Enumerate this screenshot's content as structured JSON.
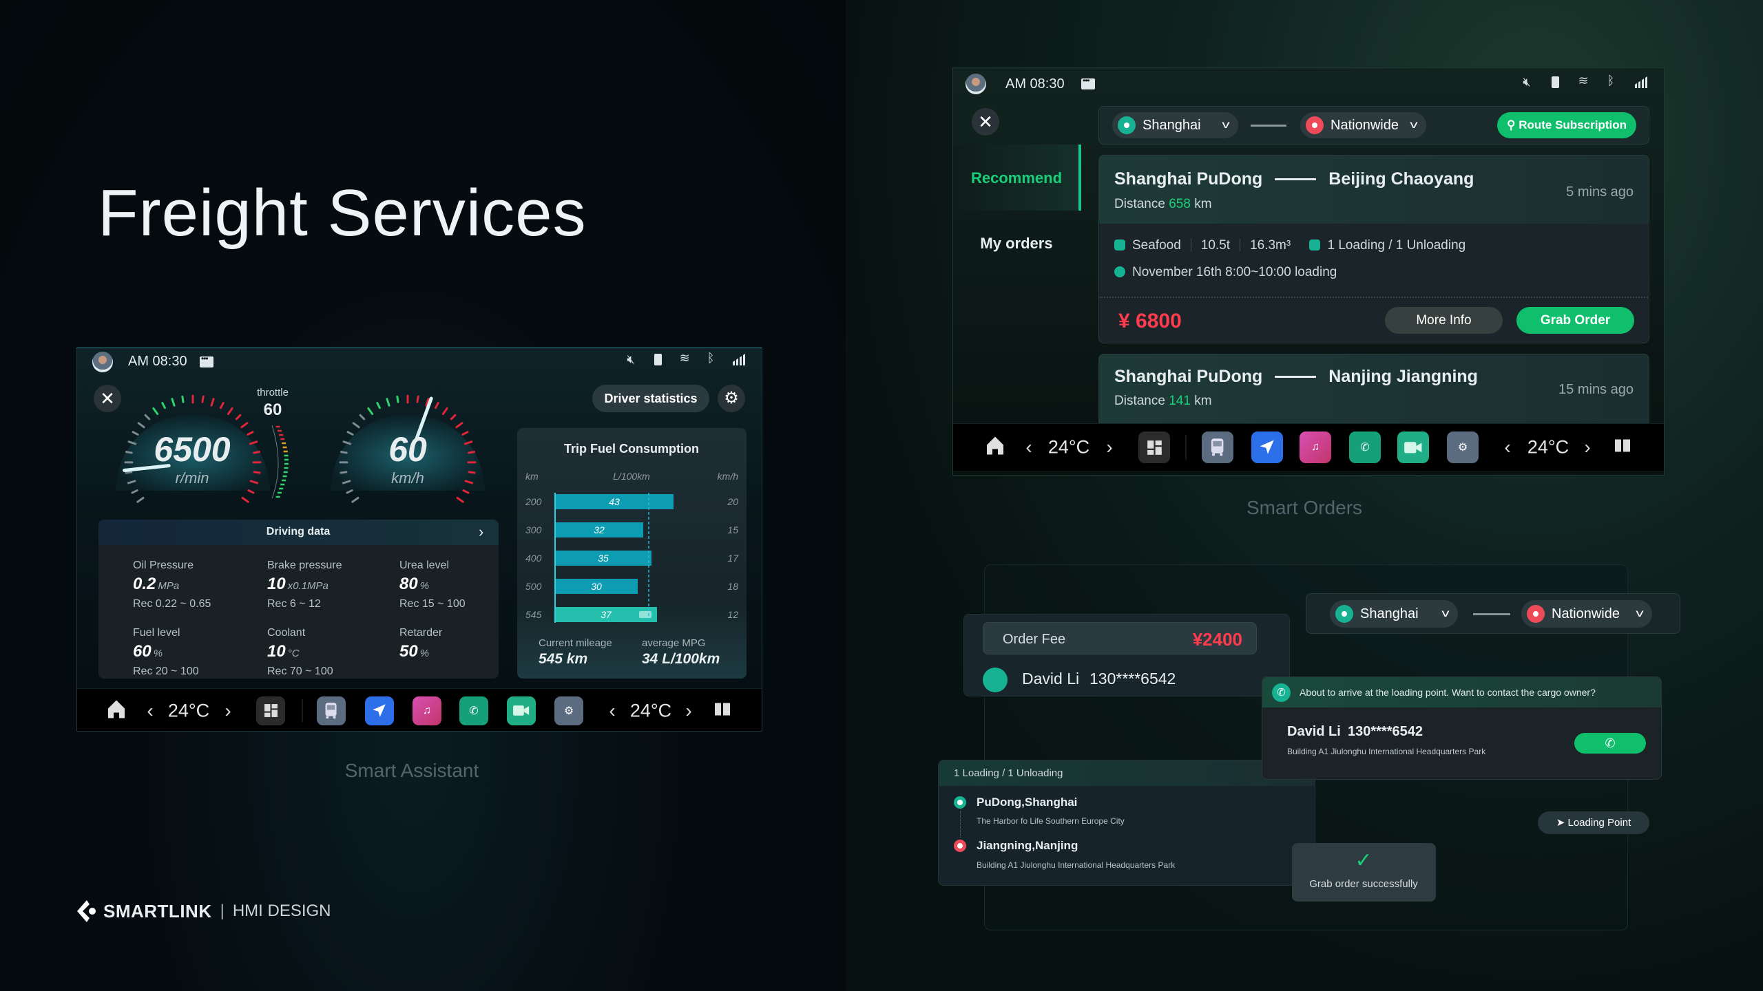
{
  "title": "Freight Services",
  "brand": {
    "name": "SMARTLINK",
    "separator": "|",
    "tagline": "HMI DESIGN"
  },
  "colors": {
    "accent_green": "#0fbf6c",
    "price_red": "#ff3b4e",
    "teal_bar": "#0e9cb3",
    "current_bar": "#25bfae"
  },
  "dock": {
    "temperature_left": "24°C",
    "temperature_right": "24°C",
    "icons": [
      "home-icon",
      "chevron-left-icon",
      "chevron-right-icon",
      "widgets-icon",
      "truck-app-icon",
      "navigation-app-icon",
      "music-app-icon",
      "phone-app-icon",
      "video-app-icon",
      "settings-app-icon",
      "split-screen-icon"
    ]
  },
  "assistant": {
    "caption": "Smart Assistant",
    "status": {
      "time": "AM 08:30"
    },
    "rpm": {
      "value": "6500",
      "unit": "r/min"
    },
    "throttle": {
      "label": "throttle",
      "value": "60"
    },
    "speed": {
      "value": "60",
      "unit": "km/h"
    },
    "driver_stats_label": "Driver statistics",
    "driving_data": {
      "title": "Driving data",
      "items": [
        {
          "label": "Oil Pressure",
          "value": "0.2",
          "unit": "MPa",
          "rec": "Rec 0.22 ~ 0.65"
        },
        {
          "label": "Brake pressure",
          "value": "10",
          "unit": "x0.1MPa",
          "rec": "Rec 6 ~ 12"
        },
        {
          "label": "Urea level",
          "value": "80",
          "unit": "%",
          "rec": "Rec 15 ~ 100"
        },
        {
          "label": "Fuel level",
          "value": "60",
          "unit": "%",
          "rec": "Rec 20 ~ 100"
        },
        {
          "label": "Coolant",
          "value": "10",
          "unit": "°C",
          "rec": "Rec 70 ~ 100"
        },
        {
          "label": "Retarder",
          "value": "50",
          "unit": "%",
          "rec": ""
        }
      ]
    },
    "fuel_summary": {
      "mileage_label": "Current mileage",
      "mileage_value": "545 km",
      "mpg_label": "average MPG",
      "mpg_value": "34 L/100km"
    }
  },
  "chart_data": {
    "type": "bar",
    "orientation": "horizontal",
    "title": "Trip Fuel Consumption",
    "left_axis_label": "km",
    "xlabel": "L/100km",
    "right_axis_label": "km/h",
    "categories": [
      "200",
      "300",
      "400",
      "500",
      "545"
    ],
    "values": [
      43,
      32,
      35,
      30,
      37
    ],
    "right_values": [
      "20",
      "15",
      "17",
      "18",
      "12"
    ],
    "average_line": 34,
    "highlight_category": "545",
    "xlim": [
      0,
      60
    ],
    "grid": false
  },
  "orders": {
    "caption": "Smart Orders",
    "status": {
      "time": "AM 08:30"
    },
    "sidebar": [
      {
        "label": "Recommend",
        "active": true
      },
      {
        "label": "My orders",
        "active": false
      }
    ],
    "filter": {
      "origin": "Shanghai",
      "destination": "Nationwide",
      "subscribe_label": "Route Subscription"
    },
    "cards": [
      {
        "from": "Shanghai PuDong",
        "to": "Beijing Chaoyang",
        "distance_prefix": "Distance",
        "distance": "658",
        "distance_unit": "km",
        "time_ago": "5 mins ago",
        "cargo": "Seafood",
        "weight": "10.5t",
        "volume": "16.3m³",
        "stops": "1 Loading / 1 Unloading",
        "schedule": "November 16th 8:00~10:00 loading",
        "price": "¥ 6800",
        "more_label": "More Info",
        "grab_label": "Grab Order"
      },
      {
        "from": "Shanghai PuDong",
        "to": "Nanjing Jiangning",
        "distance_prefix": "Distance",
        "distance": "141",
        "distance_unit": "km",
        "time_ago": "15 mins ago"
      }
    ]
  },
  "order_detail": {
    "fee_label": "Order Fee",
    "fee_value": "¥2400",
    "contact_name": "David Li",
    "contact_phone": "130****6542",
    "filter": {
      "origin": "Shanghai",
      "destination": "Nationwide"
    },
    "prompt": {
      "message": "About to arrive at the loading point. Want to contact the cargo owner?",
      "name": "David Li",
      "phone": "130****6542",
      "address": "Building A1 Jiulonghu International Headquarters Park"
    },
    "route": {
      "header": "1 Loading / 1 Unloading",
      "stops": [
        {
          "name": "PuDong,Shanghai",
          "address": "The Harbor fo Life Southern Europe City"
        },
        {
          "name": "Jiangning,Nanjing",
          "address": "Building A1 Jiulonghu International Headquarters Park"
        }
      ]
    },
    "loading_point_label": "Loading Point",
    "success_message": "Grab order successfully"
  }
}
